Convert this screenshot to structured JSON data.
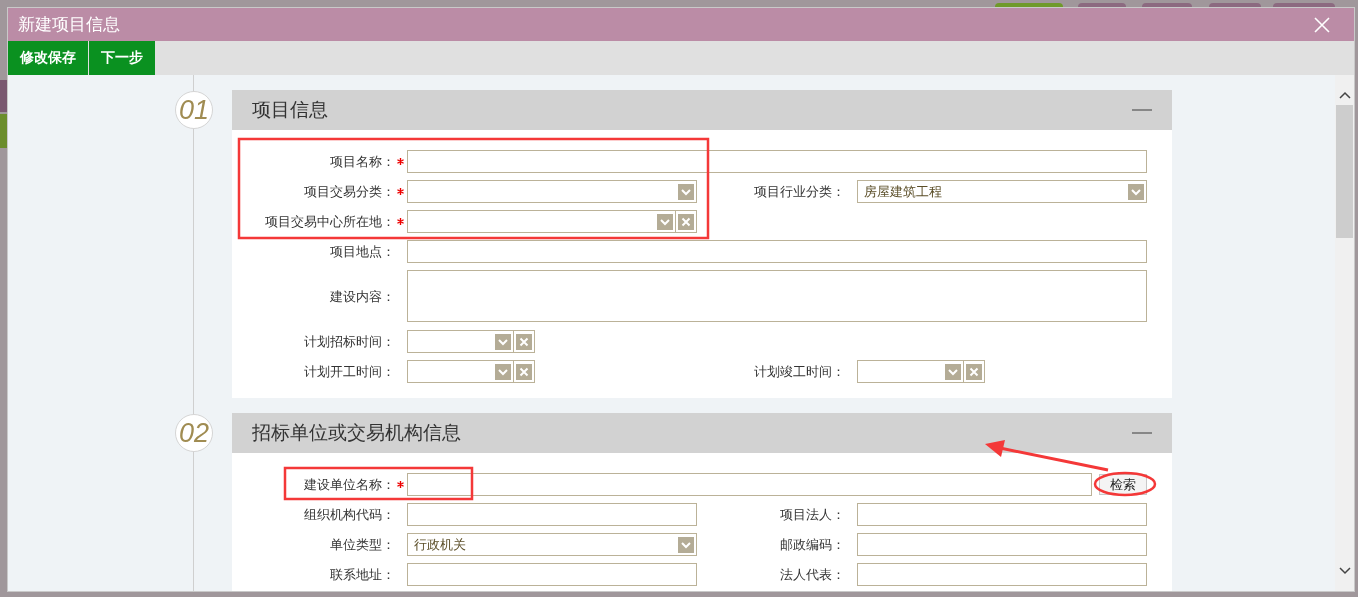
{
  "window": {
    "title": "新建项目信息"
  },
  "toolbar": [
    {
      "label": "修改保存"
    },
    {
      "label": "下一步"
    }
  ],
  "sections": [
    {
      "number": "01",
      "title": "项目信息",
      "rows": [
        {
          "fields": [
            {
              "kind": "long-text",
              "label": "项目名称：",
              "required": true
            }
          ]
        },
        {
          "fields": [
            {
              "kind": "select",
              "label": "项目交易分类：",
              "required": true
            },
            {
              "kind": "select",
              "label": "项目行业分类：",
              "required": false,
              "value": "房屋建筑工程"
            }
          ]
        },
        {
          "fields": [
            {
              "kind": "clearable-select",
              "label": "项目交易中心所在地：",
              "required": true
            }
          ]
        },
        {
          "fields": [
            {
              "kind": "long-text",
              "label": "项目地点：",
              "required": false
            }
          ]
        },
        {
          "fields": [
            {
              "kind": "textarea",
              "label": "建设内容：",
              "required": false
            }
          ]
        },
        {
          "fields": [
            {
              "kind": "date",
              "label": "计划招标时间：",
              "required": false
            }
          ]
        },
        {
          "fields": [
            {
              "kind": "date",
              "label": "计划开工时间：",
              "required": false
            },
            {
              "kind": "date",
              "label": "计划竣工时间：",
              "required": false
            }
          ]
        }
      ]
    },
    {
      "number": "02",
      "title": "招标单位或交易机构信息",
      "rows": [
        {
          "fields": [
            {
              "kind": "search-text",
              "label": "建设单位名称：",
              "required": true,
              "button": "检索"
            }
          ]
        },
        {
          "fields": [
            {
              "kind": "text",
              "label": "组织机构代码：",
              "required": false
            },
            {
              "kind": "text",
              "label": "项目法人：",
              "required": false
            }
          ]
        },
        {
          "fields": [
            {
              "kind": "select",
              "label": "单位类型：",
              "required": false,
              "value": "行政机关"
            },
            {
              "kind": "text",
              "label": "邮政编码：",
              "required": false
            }
          ]
        },
        {
          "fields": [
            {
              "kind": "text",
              "label": "联系地址：",
              "required": false
            },
            {
              "kind": "text",
              "label": "法人代表：",
              "required": false
            }
          ]
        }
      ]
    }
  ]
}
